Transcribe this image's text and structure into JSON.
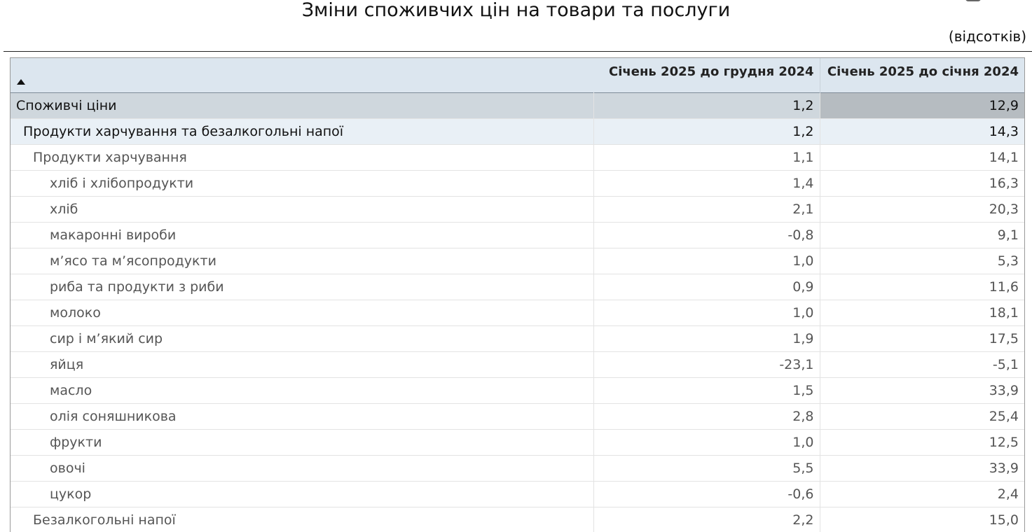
{
  "title": "Зміни споживчих цін на товари та послуги",
  "units": "(відсотків)",
  "columns": [
    "",
    "Січень 2025 до грудня 2024",
    "Січень 2025 до січня 2024"
  ],
  "rows": [
    {
      "label": "Споживчі ціни",
      "level": 0,
      "mom": "1,2",
      "yoy": "12,9"
    },
    {
      "label": "Продукти харчування та безалкогольні напої",
      "level": 1,
      "mom": "1,2",
      "yoy": "14,3"
    },
    {
      "label": "Продукти харчування",
      "level": 2,
      "mom": "1,1",
      "yoy": "14,1"
    },
    {
      "label": "хліб і хлібопродукти",
      "level": 3,
      "mom": "1,4",
      "yoy": "16,3"
    },
    {
      "label": "хліб",
      "level": 3,
      "mom": "2,1",
      "yoy": "20,3"
    },
    {
      "label": "макаронні вироби",
      "level": 3,
      "mom": "-0,8",
      "yoy": "9,1"
    },
    {
      "label": "м’ясо та м’ясопродукти",
      "level": 3,
      "mom": "1,0",
      "yoy": "5,3"
    },
    {
      "label": "риба та продукти з риби",
      "level": 3,
      "mom": "0,9",
      "yoy": "11,6"
    },
    {
      "label": "молоко",
      "level": 3,
      "mom": "1,0",
      "yoy": "18,1"
    },
    {
      "label": "сир і м’який сир",
      "level": 3,
      "mom": "1,9",
      "yoy": "17,5"
    },
    {
      "label": "яйця",
      "level": 3,
      "mom": "-23,1",
      "yoy": "-5,1"
    },
    {
      "label": "масло",
      "level": 3,
      "mom": "1,5",
      "yoy": "33,9"
    },
    {
      "label": "олія соняшникова",
      "level": 3,
      "mom": "2,8",
      "yoy": "25,4"
    },
    {
      "label": "фрукти",
      "level": 3,
      "mom": "1,0",
      "yoy": "12,5"
    },
    {
      "label": "овочі",
      "level": 3,
      "mom": "5,5",
      "yoy": "33,9"
    },
    {
      "label": "цукор",
      "level": 3,
      "mom": "-0,6",
      "yoy": "2,4"
    },
    {
      "label": "Безалкогольні напої",
      "level": 2,
      "mom": "2,2",
      "yoy": "15,0"
    }
  ]
}
